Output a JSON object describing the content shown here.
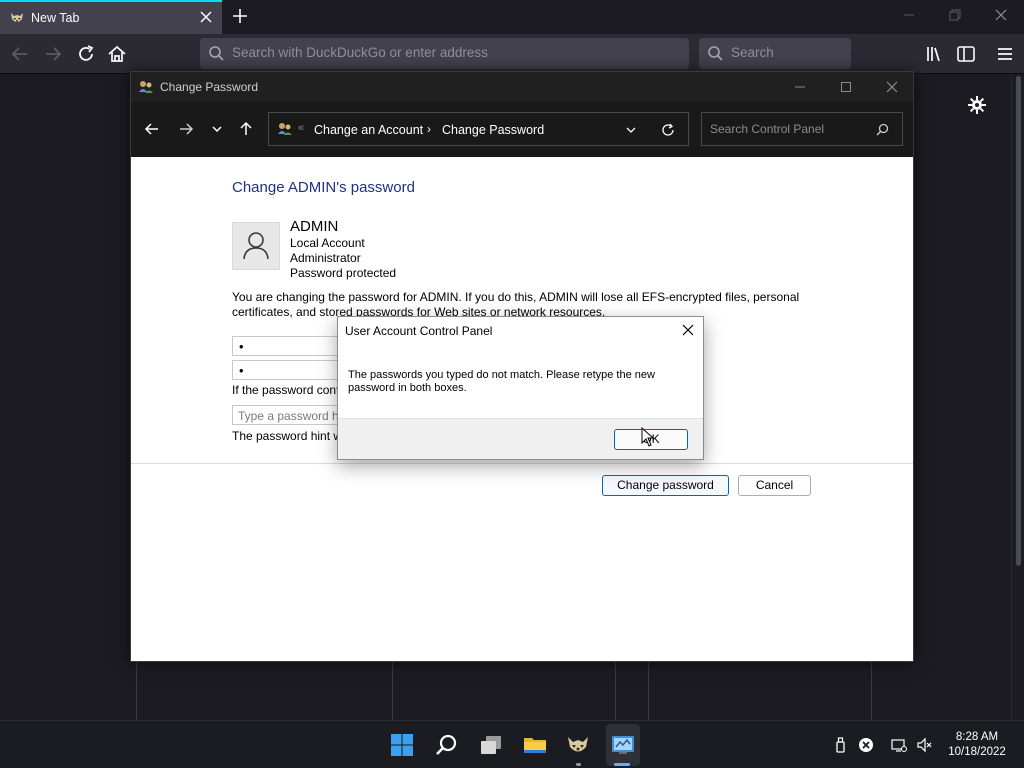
{
  "browser": {
    "tab": {
      "title": "New Tab",
      "favicon_icon": "firefox-raccoon-icon"
    },
    "urlbar": {
      "placeholder": "Search with DuckDuckGo or enter address"
    },
    "searchbar": {
      "placeholder": "Search"
    },
    "colors": {
      "accent": "#00ddff",
      "toolbar": "#2b2a33",
      "field": "#42414d"
    }
  },
  "cp_window": {
    "title": "Change Password",
    "address": {
      "crumbs": [
        "Change an Account",
        "Change Password"
      ],
      "overflow": "«"
    },
    "search": {
      "placeholder": "Search Control Panel"
    },
    "heading": "Change ADMIN's password",
    "account": {
      "name": "ADMIN",
      "lines": [
        "Local Account",
        "Administrator",
        "Password protected"
      ]
    },
    "description": "You are changing the password for ADMIN.  If you do this, ADMIN will lose all EFS-encrypted files, personal certificates, and stored passwords for Web sites or network resources.",
    "new_password_mask": "•",
    "confirm_password_mask": "•",
    "hint_label": "If the password cont",
    "hint": {
      "placeholder": "Type a password hi"
    },
    "hint_note": "The password hint w",
    "buttons": {
      "change": "Change password",
      "cancel": "Cancel"
    },
    "colors": {
      "heading": "#1e3287",
      "titlebar": "#202020"
    }
  },
  "dialog": {
    "title": "User Account Control Panel",
    "message": "The passwords you typed do not match. Please retype the new password in both boxes.",
    "ok_label": "OK"
  },
  "taskbar": {
    "time": "8:28 AM",
    "date": "10/18/2022",
    "apps": [
      "windows-start-icon",
      "search-icon",
      "task-view-icon",
      "file-explorer-icon",
      "firefox-raccoon-icon",
      "control-panel-icon"
    ]
  }
}
